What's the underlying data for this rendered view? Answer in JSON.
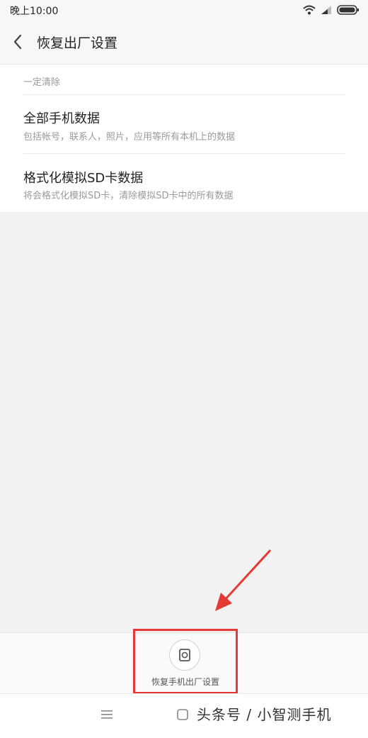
{
  "status": {
    "time": "晚上10:00",
    "icons": [
      "wifi-icon",
      "signal-icon",
      "battery-icon"
    ]
  },
  "header": {
    "title": "恢复出厂设置",
    "back_icon": "chevron-left-icon"
  },
  "section": {
    "label": "一定清除"
  },
  "items": [
    {
      "title": "全部手机数据",
      "subtitle": "包括帐号，联系人，照片，应用等所有本机上的数据"
    },
    {
      "title": "格式化模拟SD卡数据",
      "subtitle": "将会格式化模拟SD卡，清除模拟SD卡中的所有数据"
    }
  ],
  "action": {
    "label": "恢复手机出厂设置",
    "icon": "reset-icon"
  },
  "nav": {
    "icons": [
      "menu-icon",
      "home-icon"
    ]
  },
  "watermark": "头条号 / 小智测手机",
  "colors": {
    "highlight": "#e53935",
    "background": "#f2f2f2"
  }
}
